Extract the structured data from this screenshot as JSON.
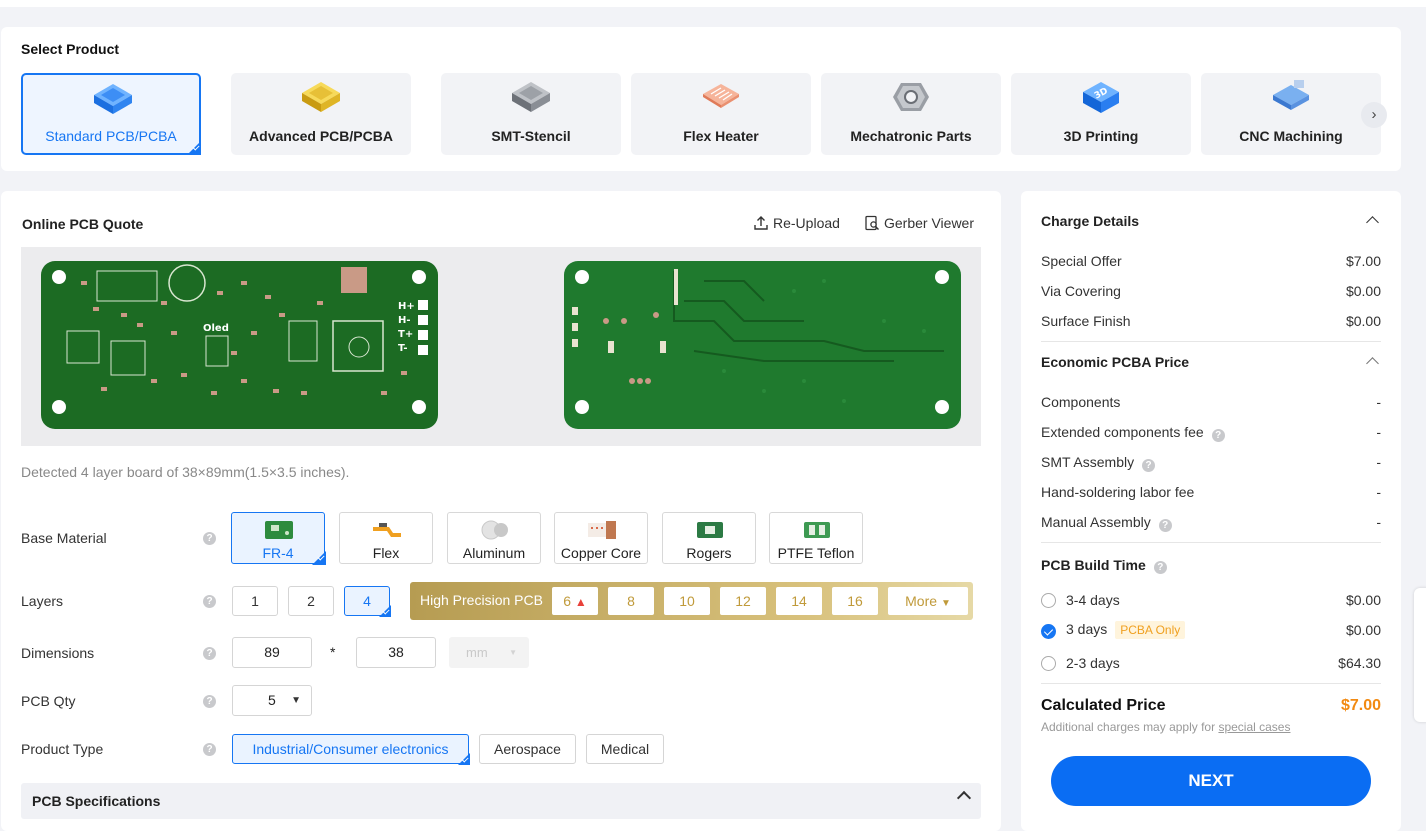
{
  "select_product": {
    "title": "Select Product",
    "items": [
      {
        "label": "Standard PCB/PCBA",
        "icon": "pcb-chip-icon",
        "active": true
      },
      {
        "label": "Advanced PCB/PCBA",
        "icon": "pcb-gold-chip-icon"
      },
      {
        "label": "SMT-Stencil",
        "icon": "stencil-chip-icon"
      },
      {
        "label": "Flex Heater",
        "icon": "flex-heater-icon"
      },
      {
        "label": "Mechatronic Parts",
        "icon": "hex-nut-icon"
      },
      {
        "label": "3D Printing",
        "icon": "3d-cube-icon"
      },
      {
        "label": "CNC Machining",
        "icon": "cnc-icon"
      }
    ]
  },
  "quote": {
    "title": "Online PCB Quote",
    "reupload": "Re-Upload",
    "gerber_viewer": "Gerber Viewer",
    "detected": "Detected 4 layer board of 38×89mm(1.5×3.5 inches).",
    "silk": {
      "oled": "Oled",
      "hplus": "H+",
      "hminus": "H-",
      "tplus": "T+",
      "tminus": "T-"
    },
    "base_material": {
      "label": "Base Material",
      "options": [
        "FR-4",
        "Flex",
        "Aluminum",
        "Copper Core",
        "Rogers",
        "PTFE Teflon"
      ]
    },
    "layers": {
      "label": "Layers",
      "options": [
        "1",
        "2",
        "4"
      ],
      "high_precision_label": "High Precision PCB",
      "hp_options": [
        "6",
        "8",
        "10",
        "12",
        "14",
        "16"
      ],
      "more": "More"
    },
    "dimensions": {
      "label": "Dimensions",
      "length": "89",
      "sep": "*",
      "width": "38",
      "unit": "mm"
    },
    "qty": {
      "label": "PCB Qty",
      "value": "5"
    },
    "product_type": {
      "label": "Product Type",
      "options": [
        "Industrial/Consumer electronics",
        "Aerospace",
        "Medical"
      ]
    },
    "specs_title": "PCB Specifications"
  },
  "charge": {
    "title": "Charge Details",
    "rows": [
      {
        "label": "Special Offer",
        "value": "$7.00"
      },
      {
        "label": "Via Covering",
        "value": "$0.00"
      },
      {
        "label": "Surface Finish",
        "value": "$0.00"
      }
    ],
    "pcba_title": "Economic PCBA Price",
    "pcba_rows": [
      {
        "label": "Components",
        "value": "-"
      },
      {
        "label": "Extended components fee",
        "value": "-"
      },
      {
        "label": "SMT Assembly",
        "value": "-"
      },
      {
        "label": "Hand-soldering labor fee",
        "value": "-"
      },
      {
        "label": "Manual Assembly",
        "value": "-"
      }
    ],
    "build_title": "PCB Build Time",
    "build_rows": [
      {
        "label": "3-4 days",
        "value": "$0.00"
      },
      {
        "label": "3 days",
        "value": "$0.00",
        "badge": "PCBA Only"
      },
      {
        "label": "2-3 days",
        "value": "$64.30"
      }
    ],
    "calc_label": "Calculated Price",
    "calc_value": "$7.00",
    "note_prefix": "Additional charges may apply for",
    "note_link": "special cases",
    "next": "NEXT"
  },
  "colors": {
    "accent": "#1676f3",
    "price": "#f28a12",
    "pcb_green": "#1c6b23"
  }
}
